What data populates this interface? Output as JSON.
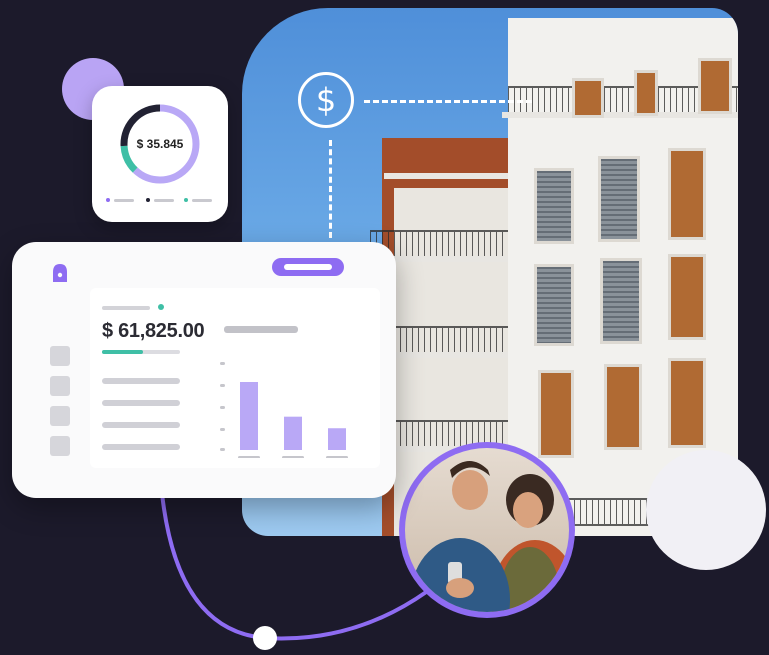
{
  "colors": {
    "background": "#1c1a2b",
    "accent_purple": "#8e6cf2",
    "bar_purple": "#b9a8f6",
    "teal": "#3fbfa6"
  },
  "donut_card": {
    "value_text": "$ 35.845",
    "segments": [
      {
        "color": "#b9a8f6",
        "fraction": 0.62
      },
      {
        "color": "#3fbfa6",
        "fraction": 0.12
      },
      {
        "color": "#222233",
        "fraction": 0.26
      }
    ],
    "legend_dot_colors": [
      "#8e6cf2",
      "#222233",
      "#3fbfa6"
    ]
  },
  "dashboard": {
    "amount_text": "$ 61,825.00",
    "progress_fraction": 0.52,
    "list_item_count": 4,
    "bars": [
      {
        "value": 1.0
      },
      {
        "value": 0.49
      },
      {
        "value": 0.32
      }
    ]
  },
  "icons": {
    "dollar": "$",
    "lock": "lock-icon"
  }
}
